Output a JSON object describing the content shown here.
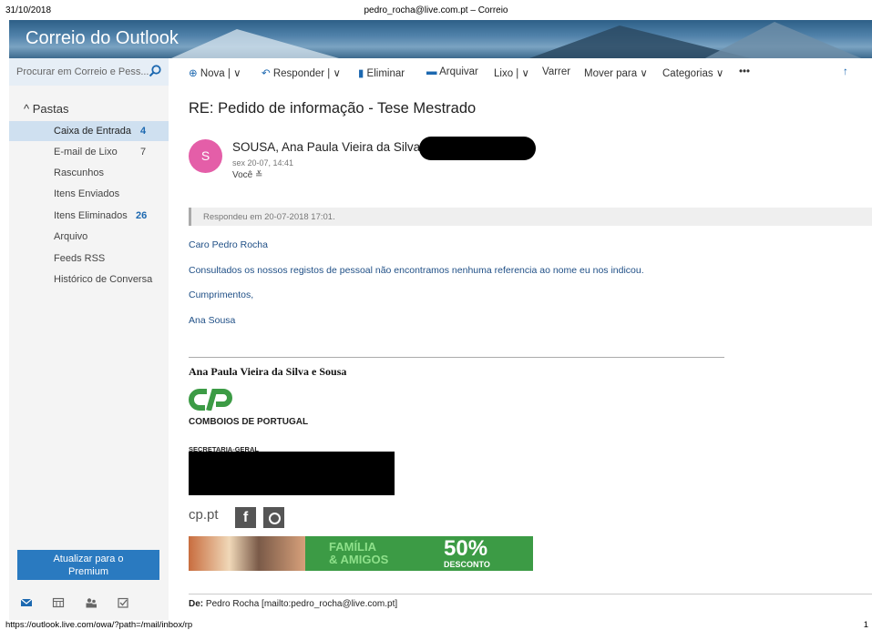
{
  "print_header": {
    "date": "31/10/2018",
    "title": "pedro_rocha@live.com.pt – Correio"
  },
  "app": {
    "brand": "Correio do Outlook"
  },
  "search": {
    "placeholder": "Procurar em Correio e Pess..."
  },
  "toolbar": {
    "new": "Nova",
    "reply": "Responder",
    "delete": "Eliminar",
    "archive": "Arquivar",
    "junk": "Lixo",
    "sweep": "Varrer",
    "move": "Mover para",
    "categories": "Categorias",
    "more": "•••"
  },
  "sidebar": {
    "header": "Pastas",
    "folders": [
      {
        "label": "Caixa de Entrada",
        "count": "4"
      },
      {
        "label": "E-mail de Lixo",
        "count": "7"
      },
      {
        "label": "Rascunhos",
        "count": ""
      },
      {
        "label": "Itens Enviados",
        "count": ""
      },
      {
        "label": "Itens Eliminados",
        "count": "26"
      },
      {
        "label": "Arquivo",
        "count": ""
      },
      {
        "label": "Feeds RSS",
        "count": ""
      },
      {
        "label": "Histórico de Conversa",
        "count": ""
      }
    ],
    "upgrade_line1": "Atualizar para o",
    "upgrade_line2": "Premium"
  },
  "message": {
    "subject": "RE: Pedido de informação - Tese Mestrado",
    "avatar_initial": "S",
    "sender": "SOUSA, Ana Paula Vieira da Silva e",
    "sent": "sex 20-07, 14:41",
    "to": "Você ≚",
    "replied_notice": "Respondeu em 20-07-2018 17:01.",
    "body": [
      "Caro Pedro Rocha",
      "Consultados os nossos registos de pessoal não encontramos nenhuma referencia ao nome eu nos indicou.",
      "Cumprimentos,",
      "Ana Sousa"
    ],
    "signature": {
      "name": "Ana Paula Vieira da Silva e Sousa",
      "company": "COMBOIOS DE PORTUGAL",
      "department": "SECRETARIA-GERAL",
      "site": "cp.pt",
      "promo_line1": "FAMÍLIA",
      "promo_line2": "& AMIGOS",
      "promo_pct": "50%",
      "promo_desc": "DESCONTO"
    },
    "quoted_from": "Pedro Rocha [mailto:pedro_rocha@live.com.pt]",
    "quoted_from_label": "De:"
  },
  "print_footer": {
    "url": "https://outlook.live.com/owa/?path=/mail/inbox/rp",
    "page": "1"
  },
  "colors": {
    "accent": "#1c68b0",
    "avatar": "#e45ea8",
    "cp_green": "#3c9b45"
  }
}
